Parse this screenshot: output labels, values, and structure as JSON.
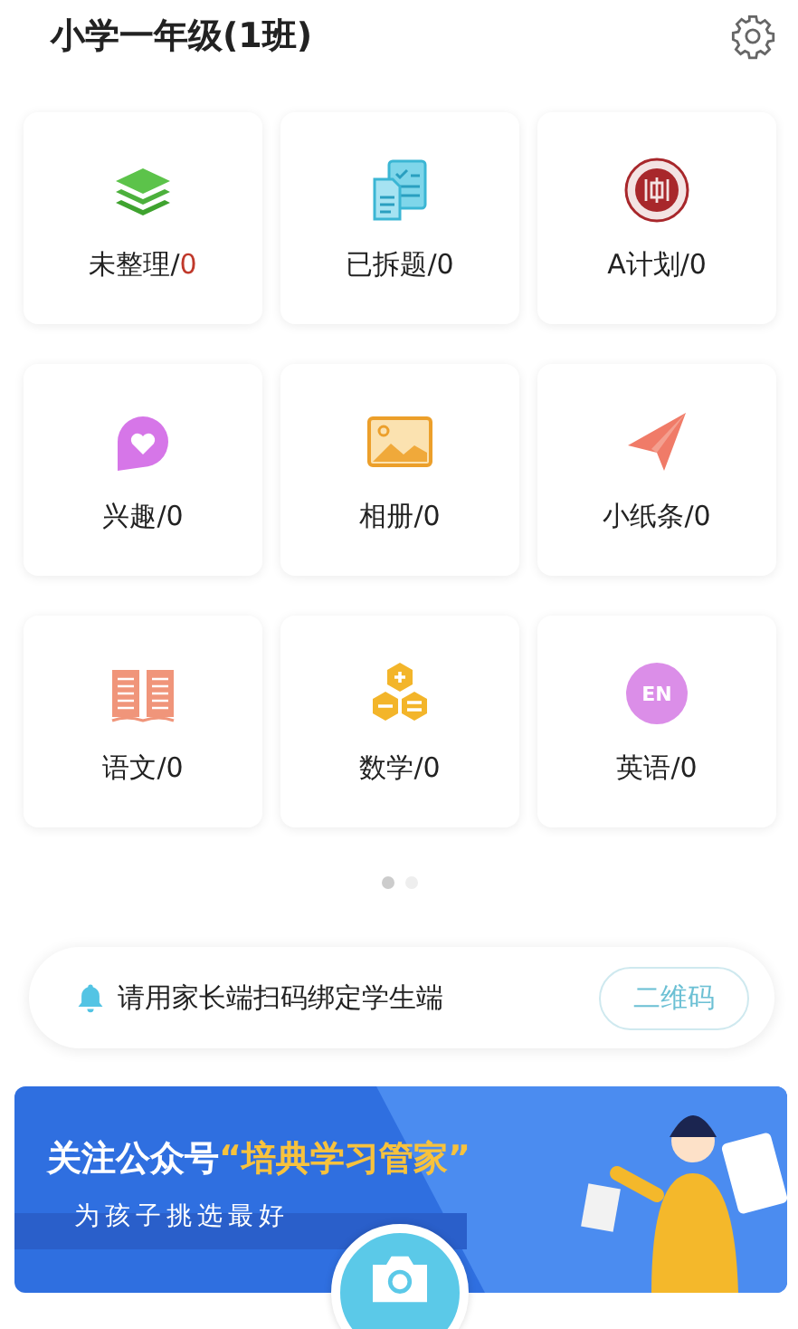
{
  "header": {
    "title": "小学一年级(1班)"
  },
  "cards": [
    {
      "label": "未整理/",
      "count": "0",
      "count_highlighted": true
    },
    {
      "label": "已拆题/",
      "count": "0",
      "count_highlighted": false
    },
    {
      "label": "A计划/",
      "count": "0",
      "count_highlighted": false
    },
    {
      "label": "兴趣/",
      "count": "0",
      "count_highlighted": false
    },
    {
      "label": "相册/",
      "count": "0",
      "count_highlighted": false
    },
    {
      "label": "小纸条/",
      "count": "0",
      "count_highlighted": false
    },
    {
      "label": "语文/",
      "count": "0",
      "count_highlighted": false
    },
    {
      "label": "数学/",
      "count": "0",
      "count_highlighted": false
    },
    {
      "label": "英语/",
      "count": "0",
      "count_highlighted": false
    }
  ],
  "page_dots": [
    {
      "selected": true
    },
    {
      "selected": false
    }
  ],
  "notice": {
    "text": "请用家长端扫码绑定学生端",
    "button": "二维码"
  },
  "banner": {
    "headline": "关注公众号",
    "brand": "“培典学习管家”",
    "subline": "为孩子挑选最好"
  },
  "english_icon_text": "EN"
}
